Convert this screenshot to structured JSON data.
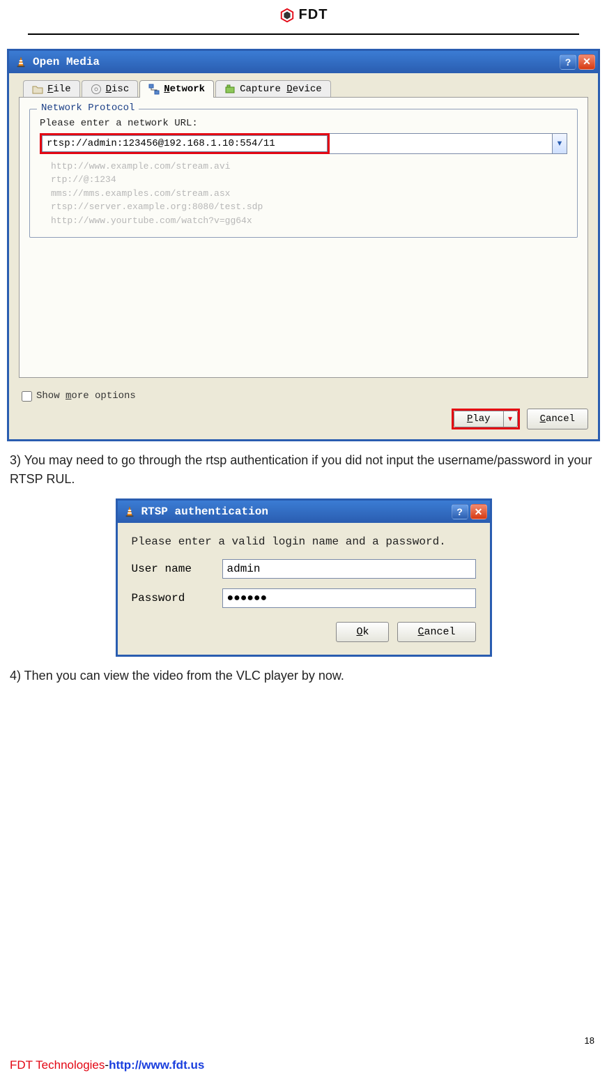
{
  "header": {
    "brand": "FDT"
  },
  "openMedia": {
    "windowTitle": "Open Media",
    "tabs": {
      "file": "File",
      "disc": "Disc",
      "network": "Network",
      "capture": "Capture Device"
    },
    "fieldsetTitle": "Network Protocol",
    "prompt": "Please enter a network URL:",
    "urlValue": "rtsp://admin:123456@192.168.1.10:554/11",
    "examples": [
      "http://www.example.com/stream.avi",
      "rtp://@:1234",
      "mms://mms.examples.com/stream.asx",
      "rtsp://server.example.org:8080/test.sdp",
      "http://www.yourtube.com/watch?v=gg64x"
    ],
    "showMore": "Show more options",
    "buttons": {
      "play": "Play",
      "cancel": "Cancel"
    }
  },
  "doc": {
    "step3": "3) You may need to go through the rtsp authentication if you did not input the username/password in your RTSP RUL.",
    "step4": "4) Then you can view the video from the VLC player by now."
  },
  "auth": {
    "windowTitle": "RTSP authentication",
    "prompt": "Please enter a valid login name and a password.",
    "labels": {
      "user": "User name",
      "pass": "Password"
    },
    "values": {
      "user": "admin",
      "pass": "●●●●●●"
    },
    "buttons": {
      "ok": "Ok",
      "cancel": "Cancel"
    }
  },
  "footer": {
    "pageNum": "18",
    "brand": "FDT Technologies",
    "sep": "-",
    "url": "http://www.fdt.us"
  }
}
